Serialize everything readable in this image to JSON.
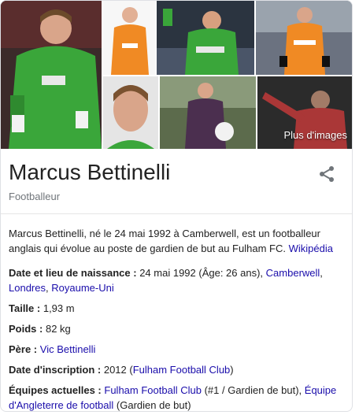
{
  "gallery": {
    "more_images_label": "Plus d'images"
  },
  "header": {
    "title": "Marcus Bettinelli",
    "subtitle": "Footballeur"
  },
  "description": {
    "text": "Marcus Bettinelli, né le 24 mai 1992 à Camberwell, est un footballeur anglais qui évolue au poste de gardien de but au Fulham FC.",
    "source_link": "Wikipédia"
  },
  "facts": {
    "birth": {
      "label": "Date et lieu de naissance :",
      "value": "24 mai 1992 (Âge: 26 ans),",
      "link1": "Camberwell",
      "sep1": ",",
      "link2": "Londres",
      "sep2": ",",
      "link3": "Royaume-Uni"
    },
    "height": {
      "label": "Taille :",
      "value": "1,93 m"
    },
    "weight": {
      "label": "Poids :",
      "value": "82 kg"
    },
    "father": {
      "label": "Père :",
      "link": "Vic Bettinelli"
    },
    "registration": {
      "label": "Date d'inscription :",
      "value": "2012 (",
      "link": "Fulham Football Club",
      "suffix": ")"
    },
    "teams": {
      "label": "Équipes actuelles :",
      "link1": "Fulham Football Club",
      "mid": "(#1 / Gardien de but),",
      "link2": "Équipe d'Angleterre de football",
      "suffix": "(Gardien de but)"
    }
  },
  "colors": {
    "link": "#1a0dab",
    "subtitle": "#70757a",
    "kit_green": "#3aa63a",
    "kit_orange": "#f08a24"
  },
  "icons": {
    "share": "share-icon"
  }
}
